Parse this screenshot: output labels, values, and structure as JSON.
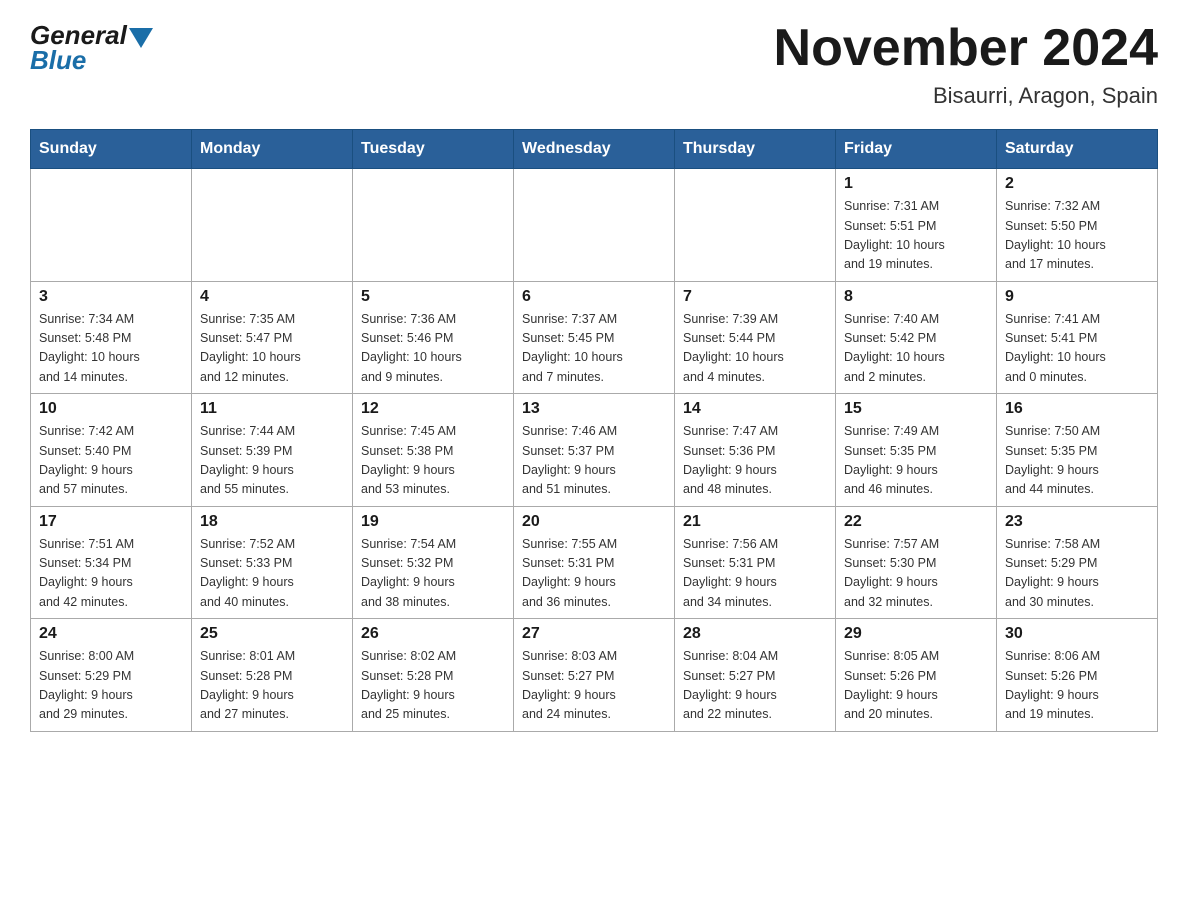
{
  "header": {
    "logo": {
      "general": "General",
      "blue": "Blue"
    },
    "title": "November 2024",
    "location": "Bisaurri, Aragon, Spain"
  },
  "days_of_week": [
    "Sunday",
    "Monday",
    "Tuesday",
    "Wednesday",
    "Thursday",
    "Friday",
    "Saturday"
  ],
  "weeks": [
    {
      "days": [
        {
          "date": "",
          "info": ""
        },
        {
          "date": "",
          "info": ""
        },
        {
          "date": "",
          "info": ""
        },
        {
          "date": "",
          "info": ""
        },
        {
          "date": "",
          "info": ""
        },
        {
          "date": "1",
          "info": "Sunrise: 7:31 AM\nSunset: 5:51 PM\nDaylight: 10 hours\nand 19 minutes."
        },
        {
          "date": "2",
          "info": "Sunrise: 7:32 AM\nSunset: 5:50 PM\nDaylight: 10 hours\nand 17 minutes."
        }
      ]
    },
    {
      "days": [
        {
          "date": "3",
          "info": "Sunrise: 7:34 AM\nSunset: 5:48 PM\nDaylight: 10 hours\nand 14 minutes."
        },
        {
          "date": "4",
          "info": "Sunrise: 7:35 AM\nSunset: 5:47 PM\nDaylight: 10 hours\nand 12 minutes."
        },
        {
          "date": "5",
          "info": "Sunrise: 7:36 AM\nSunset: 5:46 PM\nDaylight: 10 hours\nand 9 minutes."
        },
        {
          "date": "6",
          "info": "Sunrise: 7:37 AM\nSunset: 5:45 PM\nDaylight: 10 hours\nand 7 minutes."
        },
        {
          "date": "7",
          "info": "Sunrise: 7:39 AM\nSunset: 5:44 PM\nDaylight: 10 hours\nand 4 minutes."
        },
        {
          "date": "8",
          "info": "Sunrise: 7:40 AM\nSunset: 5:42 PM\nDaylight: 10 hours\nand 2 minutes."
        },
        {
          "date": "9",
          "info": "Sunrise: 7:41 AM\nSunset: 5:41 PM\nDaylight: 10 hours\nand 0 minutes."
        }
      ]
    },
    {
      "days": [
        {
          "date": "10",
          "info": "Sunrise: 7:42 AM\nSunset: 5:40 PM\nDaylight: 9 hours\nand 57 minutes."
        },
        {
          "date": "11",
          "info": "Sunrise: 7:44 AM\nSunset: 5:39 PM\nDaylight: 9 hours\nand 55 minutes."
        },
        {
          "date": "12",
          "info": "Sunrise: 7:45 AM\nSunset: 5:38 PM\nDaylight: 9 hours\nand 53 minutes."
        },
        {
          "date": "13",
          "info": "Sunrise: 7:46 AM\nSunset: 5:37 PM\nDaylight: 9 hours\nand 51 minutes."
        },
        {
          "date": "14",
          "info": "Sunrise: 7:47 AM\nSunset: 5:36 PM\nDaylight: 9 hours\nand 48 minutes."
        },
        {
          "date": "15",
          "info": "Sunrise: 7:49 AM\nSunset: 5:35 PM\nDaylight: 9 hours\nand 46 minutes."
        },
        {
          "date": "16",
          "info": "Sunrise: 7:50 AM\nSunset: 5:35 PM\nDaylight: 9 hours\nand 44 minutes."
        }
      ]
    },
    {
      "days": [
        {
          "date": "17",
          "info": "Sunrise: 7:51 AM\nSunset: 5:34 PM\nDaylight: 9 hours\nand 42 minutes."
        },
        {
          "date": "18",
          "info": "Sunrise: 7:52 AM\nSunset: 5:33 PM\nDaylight: 9 hours\nand 40 minutes."
        },
        {
          "date": "19",
          "info": "Sunrise: 7:54 AM\nSunset: 5:32 PM\nDaylight: 9 hours\nand 38 minutes."
        },
        {
          "date": "20",
          "info": "Sunrise: 7:55 AM\nSunset: 5:31 PM\nDaylight: 9 hours\nand 36 minutes."
        },
        {
          "date": "21",
          "info": "Sunrise: 7:56 AM\nSunset: 5:31 PM\nDaylight: 9 hours\nand 34 minutes."
        },
        {
          "date": "22",
          "info": "Sunrise: 7:57 AM\nSunset: 5:30 PM\nDaylight: 9 hours\nand 32 minutes."
        },
        {
          "date": "23",
          "info": "Sunrise: 7:58 AM\nSunset: 5:29 PM\nDaylight: 9 hours\nand 30 minutes."
        }
      ]
    },
    {
      "days": [
        {
          "date": "24",
          "info": "Sunrise: 8:00 AM\nSunset: 5:29 PM\nDaylight: 9 hours\nand 29 minutes."
        },
        {
          "date": "25",
          "info": "Sunrise: 8:01 AM\nSunset: 5:28 PM\nDaylight: 9 hours\nand 27 minutes."
        },
        {
          "date": "26",
          "info": "Sunrise: 8:02 AM\nSunset: 5:28 PM\nDaylight: 9 hours\nand 25 minutes."
        },
        {
          "date": "27",
          "info": "Sunrise: 8:03 AM\nSunset: 5:27 PM\nDaylight: 9 hours\nand 24 minutes."
        },
        {
          "date": "28",
          "info": "Sunrise: 8:04 AM\nSunset: 5:27 PM\nDaylight: 9 hours\nand 22 minutes."
        },
        {
          "date": "29",
          "info": "Sunrise: 8:05 AM\nSunset: 5:26 PM\nDaylight: 9 hours\nand 20 minutes."
        },
        {
          "date": "30",
          "info": "Sunrise: 8:06 AM\nSunset: 5:26 PM\nDaylight: 9 hours\nand 19 minutes."
        }
      ]
    }
  ]
}
